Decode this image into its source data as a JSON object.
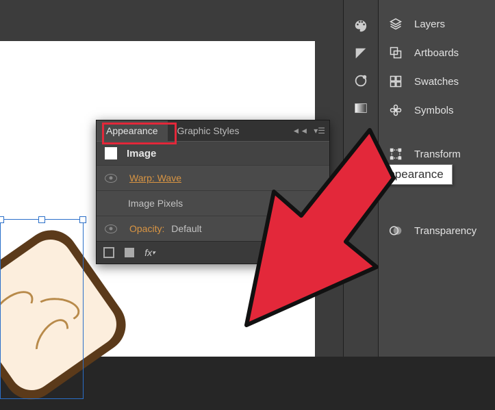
{
  "panel": {
    "tabs": {
      "active": "Appearance",
      "other": "Graphic Styles"
    },
    "header": "Image",
    "rows": {
      "warp": "Warp: Wave",
      "pixels": "Image Pixels",
      "opacity_label": "Opacity:",
      "opacity_value": "Default"
    },
    "fx": "fx"
  },
  "right": {
    "layers": "Layers",
    "artboards": "Artboards",
    "swatches": "Swatches",
    "symbols": "Symbols",
    "transform": "Transform",
    "transparency": "Transparency"
  },
  "tooltip": "Appearance"
}
